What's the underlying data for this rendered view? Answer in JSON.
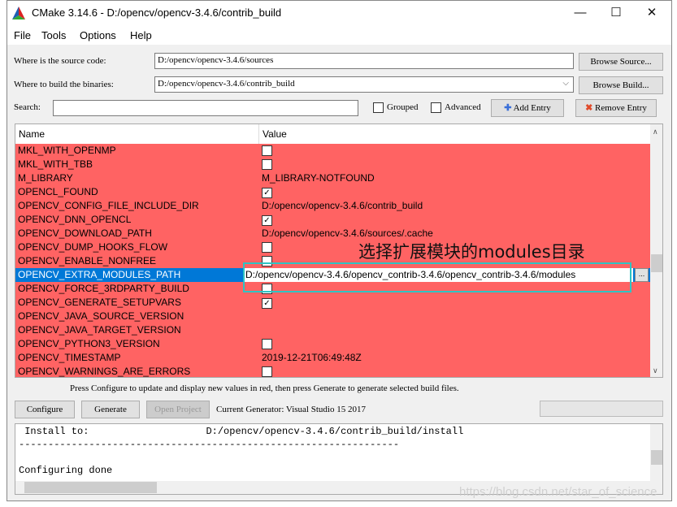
{
  "window": {
    "title": "CMake 3.14.6 - D:/opencv/opencv-3.4.6/contrib_build",
    "minimize": "—",
    "maximize": "☐",
    "close": "✕"
  },
  "menu": [
    "File",
    "Tools",
    "Options",
    "Help"
  ],
  "source": {
    "label": "Where is the source code:",
    "value": "D:/opencv/opencv-3.4.6/sources",
    "button": "Browse Source..."
  },
  "build": {
    "label": "Where to build the binaries:",
    "value": "D:/opencv/opencv-3.4.6/contrib_build",
    "button": "Browse Build..."
  },
  "search": {
    "label": "Search:",
    "value": "",
    "grouped": "Grouped",
    "advanced": "Advanced",
    "add_entry": "Add Entry",
    "remove_entry": "Remove Entry"
  },
  "table": {
    "headers": [
      "Name",
      "Value"
    ],
    "rows": [
      {
        "name": "MKL_WITH_OPENMP",
        "type": "bool",
        "checked": false
      },
      {
        "name": "MKL_WITH_TBB",
        "type": "bool",
        "checked": false
      },
      {
        "name": "M_LIBRARY",
        "type": "text",
        "value": "M_LIBRARY-NOTFOUND"
      },
      {
        "name": "OPENCL_FOUND",
        "type": "bool",
        "checked": true
      },
      {
        "name": "OPENCV_CONFIG_FILE_INCLUDE_DIR",
        "type": "text",
        "value": "D:/opencv/opencv-3.4.6/contrib_build"
      },
      {
        "name": "OPENCV_DNN_OPENCL",
        "type": "bool",
        "checked": true
      },
      {
        "name": "OPENCV_DOWNLOAD_PATH",
        "type": "text",
        "value": "D:/opencv/opencv-3.4.6/sources/.cache"
      },
      {
        "name": "OPENCV_DUMP_HOOKS_FLOW",
        "type": "bool",
        "checked": false
      },
      {
        "name": "OPENCV_ENABLE_NONFREE",
        "type": "bool",
        "checked": false
      },
      {
        "name": "OPENCV_EXTRA_MODULES_PATH",
        "type": "edit",
        "value": "D:/opencv/opencv-3.4.6/opencv_contrib-3.4.6/opencv_contrib-3.4.6/modules",
        "selected": true
      },
      {
        "name": "OPENCV_FORCE_3RDPARTY_BUILD",
        "type": "bool",
        "checked": false
      },
      {
        "name": "OPENCV_GENERATE_SETUPVARS",
        "type": "bool",
        "checked": true
      },
      {
        "name": "OPENCV_JAVA_SOURCE_VERSION",
        "type": "text",
        "value": ""
      },
      {
        "name": "OPENCV_JAVA_TARGET_VERSION",
        "type": "text",
        "value": ""
      },
      {
        "name": "OPENCV_PYTHON3_VERSION",
        "type": "bool",
        "checked": false
      },
      {
        "name": "OPENCV_TIMESTAMP",
        "type": "text",
        "value": "2019-12-21T06:49:48Z"
      },
      {
        "name": "OPENCV_WARNINGS_ARE_ERRORS",
        "type": "bool",
        "checked": false
      }
    ],
    "browse_label": "...",
    "row_color": "#ff6363",
    "selected_color": "#0078d7"
  },
  "annotation": {
    "text": "选择扩展模块的modules目录",
    "color": "#2ec4c4"
  },
  "hint": "Press Configure to update and display new values in red, then press Generate to generate selected build files.",
  "actions": {
    "configure": "Configure",
    "generate": "Generate",
    "open_project": "Open Project",
    "generator": "Current Generator: Visual Studio 15 2017"
  },
  "output": {
    "lines": [
      " Install to:                    D:/opencv/opencv-3.4.6/contrib_build/install",
      "-----------------------------------------------------------------",
      "",
      "Configuring done"
    ]
  },
  "watermark": "https://blog.csdn.net/star_of_science"
}
